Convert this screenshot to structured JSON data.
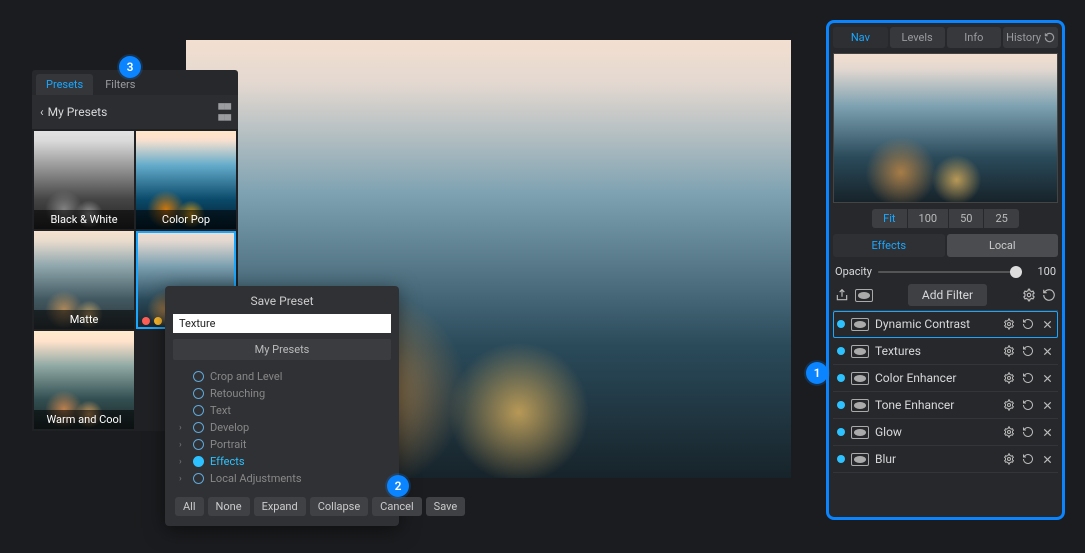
{
  "left": {
    "tabs": [
      "Presets",
      "Filters"
    ],
    "active_tab": 0,
    "back": "‹",
    "crumb": "My Presets",
    "presets": [
      {
        "label": "Black & White",
        "variant": "bw"
      },
      {
        "label": "Color Pop",
        "variant": "pop"
      },
      {
        "label": "Matte",
        "variant": "matte"
      },
      {
        "label": "",
        "variant": "sel",
        "dots": [
          "#ff5f57",
          "#febc2e",
          "#28c840"
        ]
      },
      {
        "label": "Warm and Cool",
        "variant": "warm"
      }
    ]
  },
  "save": {
    "title": "Save Preset",
    "input_value": "Texture ",
    "group": "My Presets",
    "tree": [
      {
        "label": "Crop and Level",
        "chev": false,
        "on": false
      },
      {
        "label": "Retouching",
        "chev": false,
        "on": false
      },
      {
        "label": "Text",
        "chev": false,
        "on": false
      },
      {
        "label": "Develop",
        "chev": true,
        "on": false
      },
      {
        "label": "Portrait",
        "chev": true,
        "on": false
      },
      {
        "label": "Effects",
        "chev": true,
        "on": true
      },
      {
        "label": "Local Adjustments",
        "chev": true,
        "on": false
      }
    ],
    "buttons": [
      "All",
      "None",
      "Expand",
      "Collapse",
      "Cancel",
      "Save"
    ]
  },
  "right": {
    "tabs": [
      "Nav",
      "Levels",
      "Info",
      "History"
    ],
    "active_tab": 0,
    "zoom": [
      "Fit",
      "100",
      "50",
      "25"
    ],
    "zoom_active": 0,
    "mode_tabs": [
      "Effects",
      "Local"
    ],
    "mode_active": 0,
    "opacity_label": "Opacity",
    "opacity_value": "100",
    "add_filter": "Add Filter",
    "filters": [
      {
        "name": "Dynamic Contrast",
        "sel": true
      },
      {
        "name": "Textures"
      },
      {
        "name": "Color Enhancer"
      },
      {
        "name": "Tone Enhancer"
      },
      {
        "name": "Glow"
      },
      {
        "name": "Blur"
      }
    ]
  },
  "callouts": {
    "1": "1",
    "2": "2",
    "3": "3"
  }
}
